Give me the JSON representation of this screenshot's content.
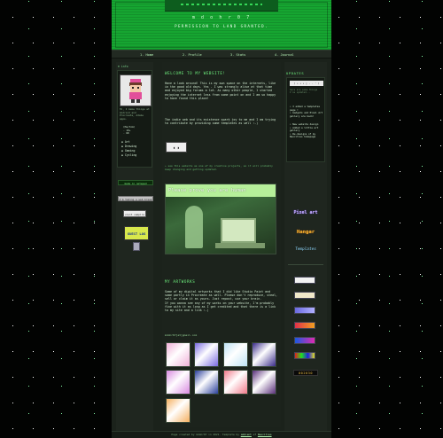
{
  "header": {
    "title": "m d o h r 0 7",
    "subtitle": "PERMISSION TO LAND GRANTED."
  },
  "nav": [
    {
      "num": "1.",
      "label": "Home"
    },
    {
      "num": "2.",
      "label": "Profile"
    },
    {
      "num": "3.",
      "label": "Stats"
    },
    {
      "num": "4.",
      "label": "Journal"
    }
  ],
  "sidebar": {
    "info_label": "♦ info",
    "bio": "Hi, I make things at Android and Procreate, Adobe apps.",
    "stats": [
      "(He/him)",
      "- 19+",
      "- UK"
    ],
    "hobbies": [
      "Art",
      "Drawing",
      "Gaming",
      "Cycling"
    ],
    "buttons": [
      "made in notepad",
      "I'm taking a web break",
      "visit vampire",
      "GUEST LOG"
    ]
  },
  "main": {
    "welcome_heading": "WELCOME TO MY WEBSITE!",
    "welcome_p1": "Have a look around! This is my own space on the internets, like in the good old days. Yes - I was strongly alive at that time and enjoyed big forums a lot. As many other people, I started enjoying the internet less from some point on and I am so happy to have found this place!",
    "welcome_p2": "The indie web and its existence spark joy to me and I am trying to contribute by providing some templates as well :-)",
    "tv_text": "◖ ◗",
    "note": "✦ see this website as one of my creative projects, so it will probably keep changing and getting updated.",
    "banner_text": "Please prove you are human",
    "artworks_heading": "MY ARTWORKS",
    "artworks_p": "Some of my digital artworks that I did like Studio Paint and some partly in Procreate as well. Please don't reproduce, steal, sell or claim it as yours. Just repost, use your brain.\nIf you wanna see any of my works on your website, I'm probably fine with it as long as I get credited and that there is a link to my site and a link :-)",
    "email": "mdohr07[at]gmail.com",
    "thumb_colors": [
      "#f0b0d8",
      "#7a6ae0",
      "#bfe3f5",
      "#3a2b8a",
      "#d98ae0",
      "#2a3f9a",
      "#f07a8a",
      "#5a2f7a",
      "#f5b060"
    ]
  },
  "updates": {
    "heading": "UPDATES",
    "status_box": "( • • • | - - ' )",
    "subtitle_text": "here are some things I've updated...",
    "items": [
      "I added a templates page !",
      "Gadgets and Pixel Art gallery are back!",
      "New website design",
      "Added a little art gallery",
      "Re-designs of my Neocities homepage"
    ],
    "link_words": [
      "Pixel art",
      "Hangar",
      "Templates"
    ],
    "counter": "002030"
  },
  "footer": {
    "text": "Page created by mdohr07 in 2021. Template by",
    "link1": "ambient",
    "and": "of",
    "link2": "Neocities"
  },
  "colors": {
    "accent": "#16a531",
    "bg": "#1b221b",
    "heading": "#6ff27f"
  }
}
